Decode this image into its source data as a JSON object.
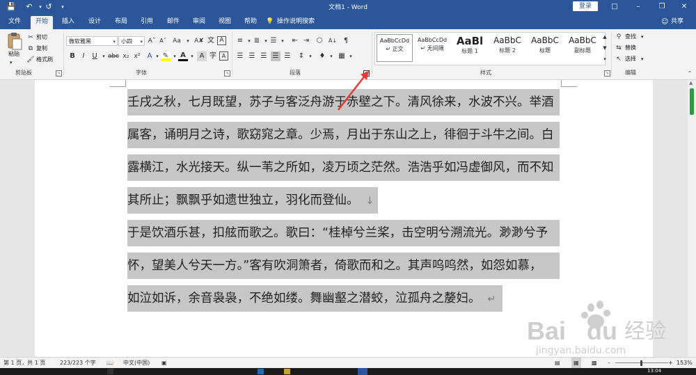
{
  "app": {
    "title": "文档1 - Word",
    "login": "登录",
    "share": "共享",
    "search_hint": "操作说明搜索"
  },
  "menu_tabs": [
    "文件",
    "开始",
    "插入",
    "设计",
    "布局",
    "引用",
    "邮件",
    "审阅",
    "视图",
    "帮助"
  ],
  "active_tab": "开始",
  "ribbon": {
    "clipboard": {
      "label": "剪贴板",
      "paste": "粘贴",
      "cut": "剪切",
      "copy": "复制",
      "format_painter": "格式刷"
    },
    "font": {
      "label": "字体",
      "font_name": "微软雅黑",
      "font_size": "小四"
    },
    "paragraph": {
      "label": "段落"
    },
    "styles": {
      "label": "样式",
      "items": [
        {
          "sample": "AaBbCcDd",
          "name": "↵ 正文"
        },
        {
          "sample": "AaBbCcDd",
          "name": "↵ 无间隔"
        },
        {
          "sample": "AaBl",
          "name": "标题 1"
        },
        {
          "sample": "AaBbC",
          "name": "标题 2"
        },
        {
          "sample": "AaBbC",
          "name": "标题"
        },
        {
          "sample": "AaBbC",
          "name": "副标题"
        }
      ]
    },
    "editing": {
      "label": "编辑",
      "find": "查找",
      "replace": "替换",
      "select": "选择"
    }
  },
  "document": {
    "lines": [
      "壬戌之秋，七月既望，苏子与客泛舟游于赤壁之下。清风徐来，水波不兴。举酒",
      "属客，诵明月之诗，歌窈窕之章。少焉，月出于东山之上，徘徊于斗牛之间。白",
      "露横江，水光接天。纵一苇之所如，凌万顷之茫然。浩浩乎如冯虚御风，而不知",
      "其所止；飘飘乎如遗世独立，羽化而登仙。",
      "于是饮酒乐甚，扣舷而歌之。歌曰：“桂棹兮兰桨，击空明兮溯流光。渺渺兮予",
      "怀，望美人兮天一方。”客有吹洞箫者，倚歌而和之。其声呜呜然，如怨如慕，",
      "如泣如诉，余音袅袅，不绝如缕。舞幽壑之潜蛟，泣孤舟之嫠妇。"
    ],
    "paragraph_mark": "↓",
    "end_mark": "↵"
  },
  "status": {
    "page": "第 1 页，共 1 页",
    "words": "223/223 个字",
    "language": "中文(中国)",
    "zoom": "153%"
  },
  "watermark": {
    "brand": "Bai",
    "brand2": "du",
    "cn": "经验",
    "url": "jingyan.baidu.com"
  },
  "colors": {
    "word_blue": "#2b579a",
    "selection": "#c6c6c6",
    "annotation_red": "#e53935"
  }
}
